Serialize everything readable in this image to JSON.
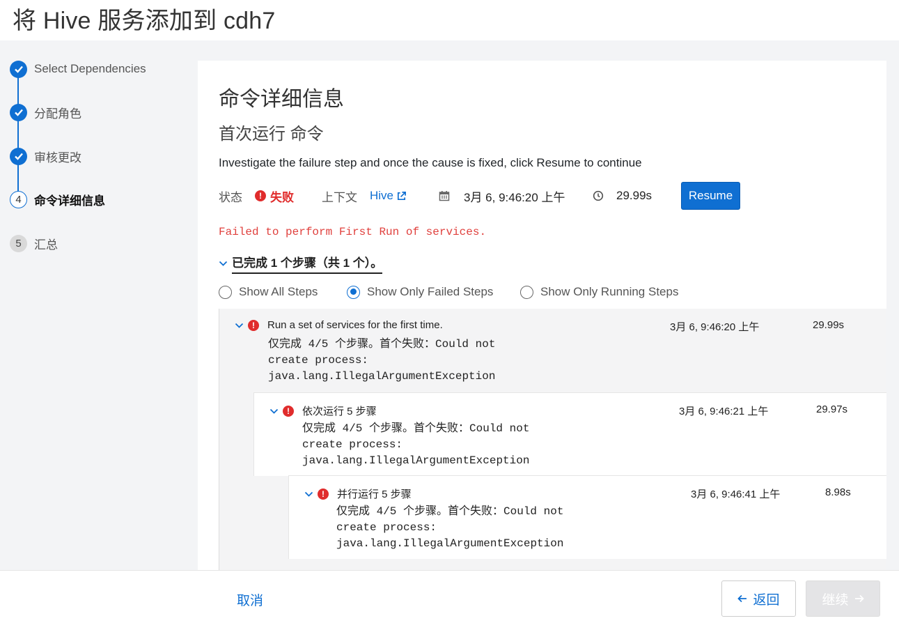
{
  "page": {
    "title": "将 Hive 服务添加到 cdh7"
  },
  "stepper": {
    "steps": [
      {
        "label": "Select Dependencies",
        "state": "done"
      },
      {
        "label": "分配角色",
        "state": "done"
      },
      {
        "label": "审核更改",
        "state": "done"
      },
      {
        "label": "命令详细信息",
        "state": "current",
        "number": "4"
      },
      {
        "label": "汇总",
        "state": "pending",
        "number": "5"
      }
    ]
  },
  "command": {
    "title": "命令详细信息",
    "subtitle": "首次运行 命令",
    "description": "Investigate the failure step and once the cause is fixed, click Resume to continue",
    "status_label": "状态",
    "status_value": "失败",
    "context_label": "上下文",
    "context_link": "Hive",
    "timestamp": "3月 6, 9:46:20 上午",
    "duration": "29.99s",
    "resume_label": "Resume",
    "error_message": "Failed to perform First Run of services.",
    "summary": "已完成 1 个步骤（共 1 个）。"
  },
  "filters": {
    "options": [
      "Show All Steps",
      "Show Only Failed Steps",
      "Show Only Running Steps"
    ],
    "selected": "Show Only Failed Steps"
  },
  "steps": [
    {
      "title": "Run a set of services for the first time.",
      "message": "仅完成 4/5 个步骤。首个失败：Could not\ncreate process:\njava.lang.IllegalArgumentException",
      "time": "3月 6, 9:46:20 上午",
      "duration": "29.99s"
    },
    {
      "title": "依次运行 5 步骤",
      "message": "仅完成 4/5 个步骤。首个失败：Could not\ncreate process:\njava.lang.IllegalArgumentException",
      "time": "3月 6, 9:46:21 上午",
      "duration": "29.97s"
    },
    {
      "title": "并行运行 5 步骤",
      "message": "仅完成 4/5 个步骤。首个失败：Could not\ncreate process:\njava.lang.IllegalArgumentException",
      "time": "3月 6, 9:46:41 上午",
      "duration": "8.98s"
    }
  ],
  "footer": {
    "cancel_label": "取消",
    "back_label": "返回",
    "next_label": "继续"
  },
  "colors": {
    "accent": "#0f6fd2",
    "error": "#e02c2c"
  }
}
